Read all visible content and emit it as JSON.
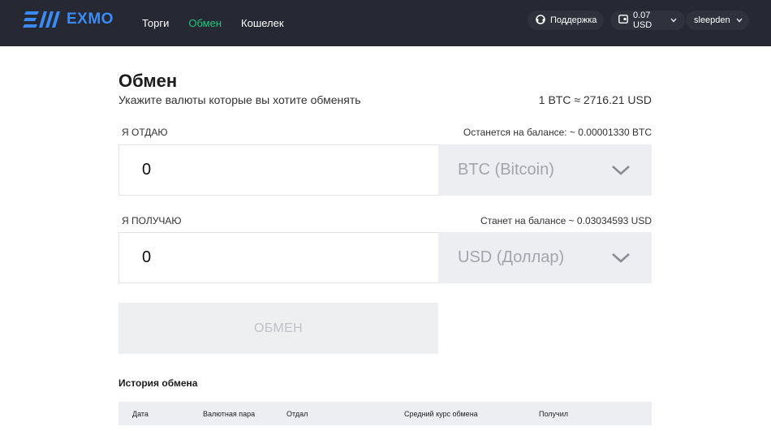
{
  "header": {
    "logo_text": "EXMO",
    "nav": [
      {
        "label": "Торги",
        "active": false
      },
      {
        "label": "Обмен",
        "active": true
      },
      {
        "label": "Кошелек",
        "active": false
      }
    ],
    "support_label": "Поддержка",
    "balance_label": "0.07 USD",
    "username": "sleepden"
  },
  "colors": {
    "header_bg": "#262833",
    "accent_green": "#1fc77e",
    "logo_blue": "#3b8bf5"
  },
  "exchange": {
    "title": "Обмен",
    "subtitle": "Укажите валюты которые вы хотите обменять",
    "rate": "1 BTC ≈ 2716.21 USD",
    "give": {
      "label": "Я отдаю",
      "note": "Останется на балансе: ~ 0.00001330 BTC",
      "amount": "0",
      "currency": "BTC (Bitcoin)"
    },
    "receive": {
      "label": "Я получаю",
      "note": "Станет на балансе ~ 0.03034593 USD",
      "amount": "0",
      "currency": "USD (Доллар)"
    },
    "submit_label": "ОБМЕН"
  },
  "history": {
    "title": "История обмена",
    "columns": [
      "Дата",
      "Валютная пара",
      "Отдал",
      "Средний курс обмена",
      "Получил"
    ]
  }
}
